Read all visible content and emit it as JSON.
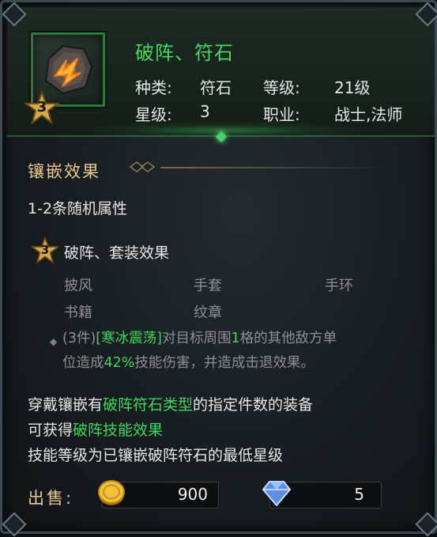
{
  "item": {
    "title": "破阵、符石",
    "star_level": "3",
    "icon": "rune-stone-icon"
  },
  "stats": {
    "type_label": "种类:",
    "type_value": "符石",
    "level_label": "等级:",
    "level_value": "21级",
    "star_label": "星级:",
    "star_value": "3",
    "class_label": "职业:",
    "class_value": "战士,法师"
  },
  "inlay": {
    "section_title": "镶嵌效果",
    "random_attr": "1-2条随机属性",
    "set_badge": "3",
    "set_title": "破阵、套装效果",
    "set_items": [
      "披风",
      "手套",
      "手环",
      "书籍",
      "纹章"
    ],
    "effect_count": "(3件)",
    "effect_name": "[寒冰震荡]",
    "effect_text_1": "对目标周围",
    "effect_num": "1",
    "effect_text_2": "格的其他敌方单",
    "effect_text_3": "位造成",
    "effect_pct": "42%",
    "effect_text_4": "技能伤害，并造成击退效果。"
  },
  "note": {
    "line1_a": "穿戴镶嵌有",
    "line1_b": "破阵符石类型",
    "line1_c": "的指定件数的装备",
    "line2_a": "可获得",
    "line2_b": "破阵技能效果",
    "line3": "技能等级为已镶嵌破阵符石的最低星级"
  },
  "sell": {
    "label": "出售:",
    "gold": "900",
    "gem": "5"
  },
  "colors": {
    "accent_green": "#3dd65a",
    "gold_title": "#e8c98e"
  }
}
